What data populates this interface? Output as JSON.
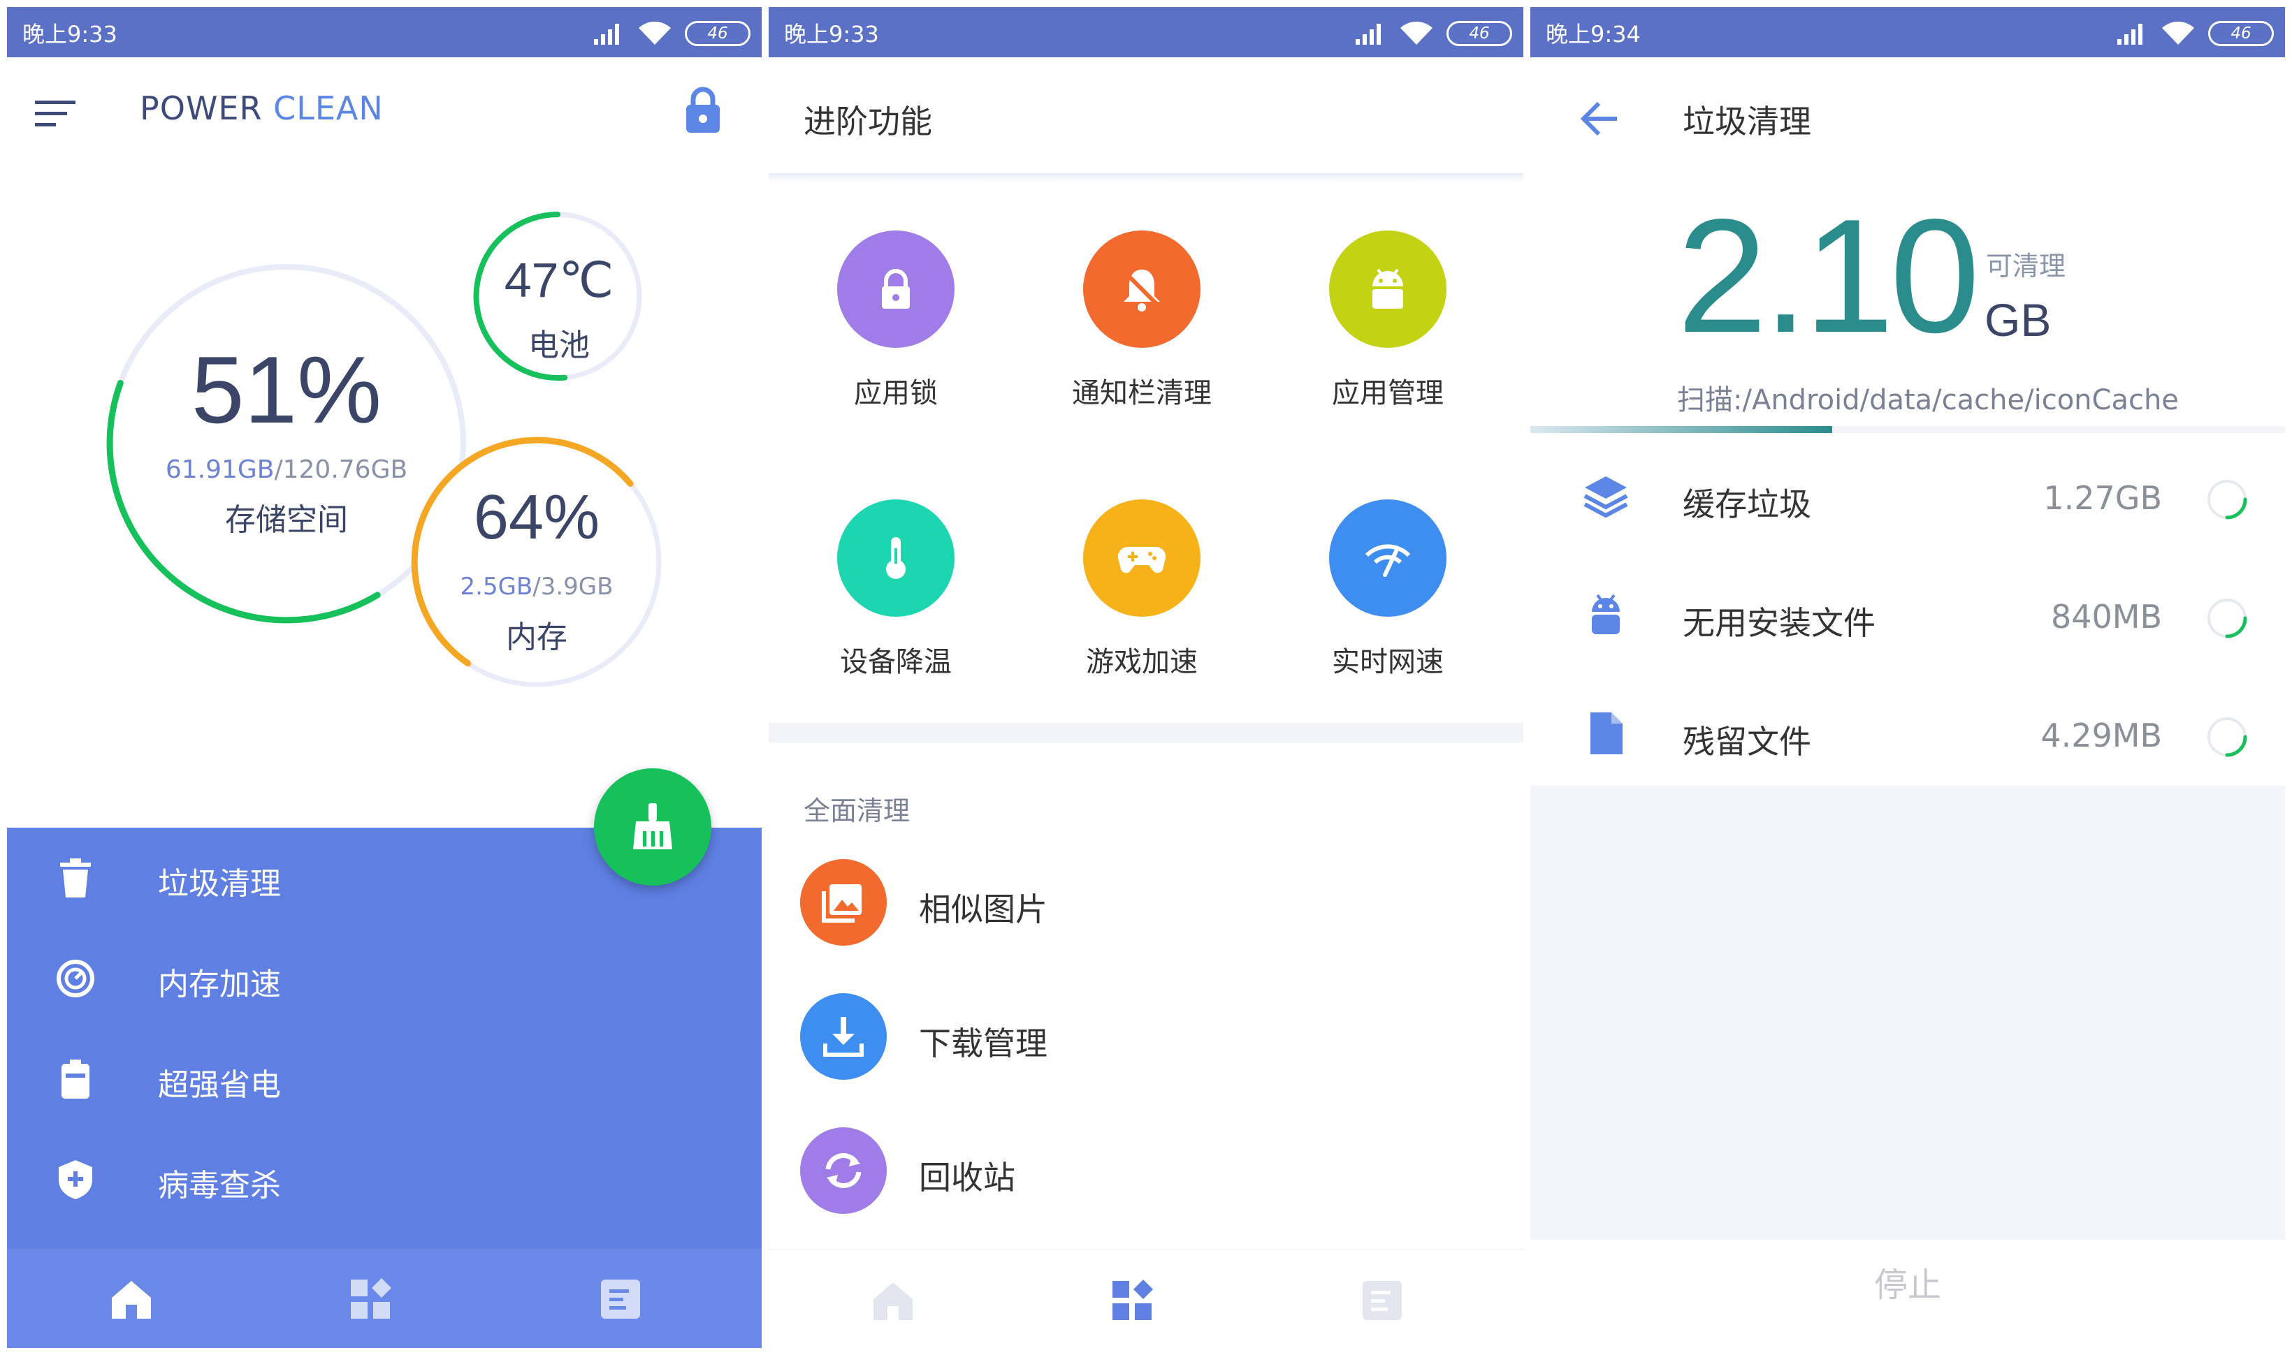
{
  "panel1": {
    "status": {
      "time": "晚上9:33",
      "battery": "46"
    },
    "app_title_part1": "POWER ",
    "app_title_part2": "CLEAN",
    "storage": {
      "percent": "51%",
      "detail_used": "61.91GB",
      "detail_total": "/120.76GB",
      "label": "存储空间",
      "fraction": 0.51
    },
    "battery": {
      "temp": "47℃",
      "label": "电池"
    },
    "memory": {
      "percent": "64%",
      "detail_used": "2.5GB",
      "detail_total": "/3.9GB",
      "label": "内存",
      "fraction": 0.64
    },
    "drawer_items": [
      {
        "label": "垃圾清理",
        "icon": "trash-icon"
      },
      {
        "label": "内存加速",
        "icon": "speedometer-icon"
      },
      {
        "label": "超强省电",
        "icon": "battery-icon"
      },
      {
        "label": "病毒查杀",
        "icon": "shield-icon"
      }
    ],
    "colors": {
      "accent": "#5f7fe3",
      "green": "#16c05a",
      "orange": "#f5a623",
      "status": "#5b71c6"
    }
  },
  "panel2": {
    "status": {
      "time": "晚上9:33",
      "battery": "46"
    },
    "title": "进阶功能",
    "features": [
      {
        "label": "应用锁",
        "color": "#a07ce8",
        "icon": "lock-icon"
      },
      {
        "label": "通知栏清理",
        "color": "#f26a2d",
        "icon": "bell-off-icon"
      },
      {
        "label": "应用管理",
        "color": "#c3d313",
        "icon": "android-icon"
      },
      {
        "label": "设备降温",
        "color": "#1bd6b1",
        "icon": "thermometer-icon"
      },
      {
        "label": "游戏加速",
        "color": "#f7b21a",
        "icon": "gamepad-icon"
      },
      {
        "label": "实时网速",
        "color": "#3d8ef0",
        "icon": "wifi-speed-icon"
      }
    ],
    "section_title": "全面清理",
    "list": [
      {
        "label": "相似图片",
        "color": "#f26a2d",
        "icon": "images-icon"
      },
      {
        "label": "下载管理",
        "color": "#3d8ef0",
        "icon": "download-icon"
      },
      {
        "label": "回收站",
        "color": "#a07ce8",
        "icon": "recycle-icon"
      }
    ]
  },
  "panel3": {
    "status": {
      "time": "晚上9:34",
      "battery": "46"
    },
    "title": "垃圾清理",
    "size": "2.10",
    "cleanable_label": "可清理",
    "unit": "GB",
    "scan_path": "扫描:/Android/data/cache/iconCache",
    "progress": 0.4,
    "items": [
      {
        "label": "缓存垃圾",
        "size": "1.27GB",
        "icon": "layers-icon"
      },
      {
        "label": "无用安装文件",
        "size": "840MB",
        "icon": "android-icon"
      },
      {
        "label": "残留文件",
        "size": "4.29MB",
        "icon": "file-icon"
      }
    ],
    "stop_label": "停止"
  }
}
